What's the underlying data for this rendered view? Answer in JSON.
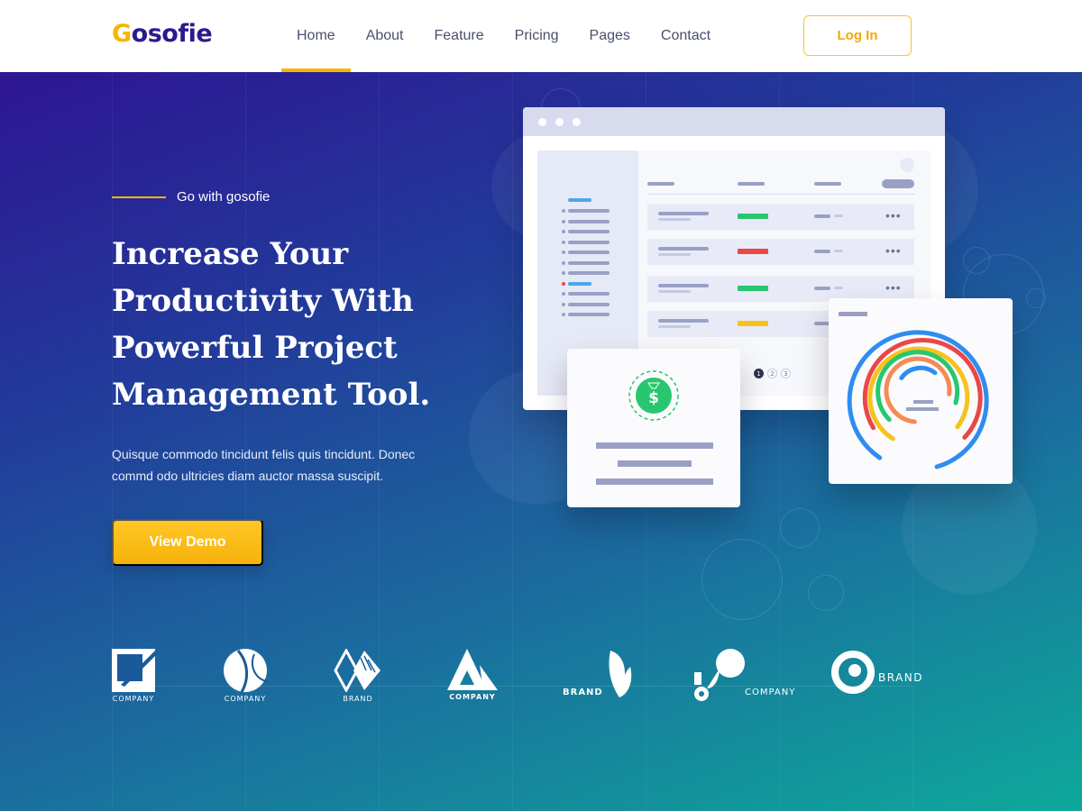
{
  "navbar": {
    "logo_initial": "G",
    "logo_rest": "osofie",
    "items": [
      {
        "label": "Home",
        "active": true
      },
      {
        "label": "About"
      },
      {
        "label": "Feature"
      },
      {
        "label": "Pricing"
      },
      {
        "label": "Pages"
      },
      {
        "label": "Contact"
      }
    ],
    "login_label": "Log In"
  },
  "hero": {
    "tagline": "Go with gosofie",
    "headline": "Increase Your Productivity With Powerful Project Management Tool.",
    "description": "Quisque commodo tincidunt felis quis tincidunt. Donec commd  odo ultricies diam auctor massa suscipit.",
    "cta_label": "View Demo"
  },
  "illustration": {
    "pagination": [
      "1",
      "2",
      "3"
    ],
    "money_symbol": "$",
    "status_colors": [
      "#28c76f",
      "#ea4848",
      "#28c76f",
      "#f7c21b"
    ]
  },
  "brands": [
    {
      "label": "COMPANY",
      "icon": "square-corner-icon"
    },
    {
      "label": "COMPANY",
      "icon": "split-circle-icon"
    },
    {
      "label": "BRAND",
      "icon": "double-diamond-icon"
    },
    {
      "label": "COMPANY",
      "icon": "triangle-mountain-icon"
    },
    {
      "label": "BRAND",
      "icon": "leaf-icon"
    },
    {
      "label": "COMPANY",
      "icon": "droplet-icon"
    },
    {
      "label": "BRAND",
      "icon": "swirl-ring-icon"
    }
  ],
  "colors": {
    "accent": "#f7b500",
    "brand_dark": "#2b1a8c",
    "gradient_start": "#2e1594",
    "gradient_end": "#0ea99b"
  }
}
